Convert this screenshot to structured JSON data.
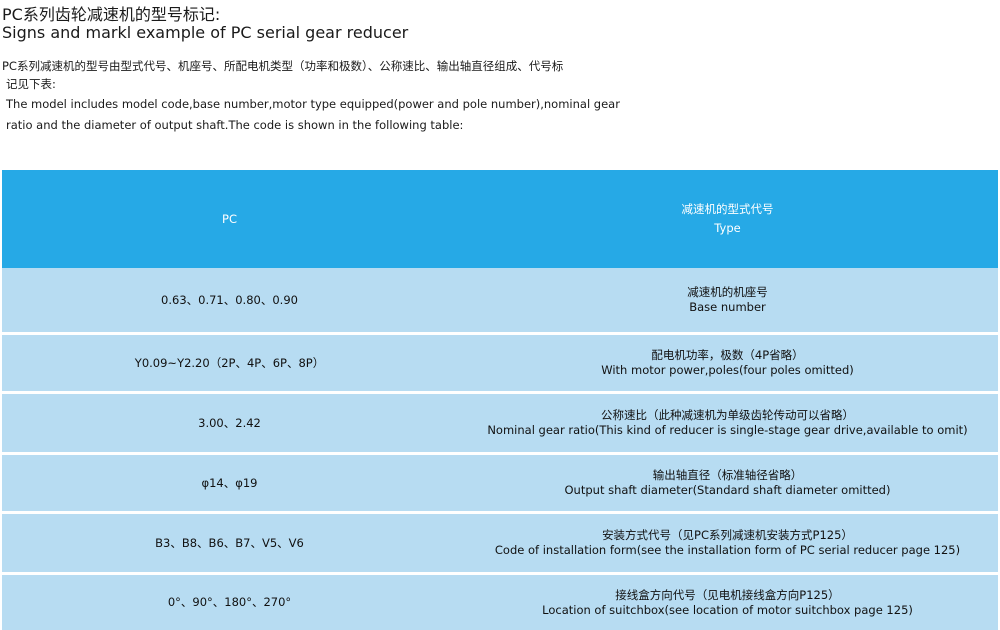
{
  "heading": {
    "title_cn": "PC系列齿轮减速机的型号标记:",
    "title_en": "Signs and markl example of PC serial gear reducer"
  },
  "intro": {
    "line1": "PC系列减速机的型号由型式代号、机座号、所配电机类型（功率和极数）、公称速比、输出轴直径组成、代号标",
    "line2": "记见下表:",
    "line3": "The model includes model code,base number,motor type equipped(power and pole number),nominal gear",
    "line4": "ratio and the diameter of output shaft.The code is shown in the following table:"
  },
  "table": {
    "header": {
      "left": "PC",
      "right_cn": "减速机的型式代号",
      "right_en": "Type"
    },
    "rows": [
      {
        "left": "0.63、0.71、0.80、0.90",
        "right_cn": "减速机的机座号",
        "right_en": "Base number"
      },
      {
        "left": "Y0.09~Y2.20（2P、4P、6P、8P）",
        "right_cn": "配电机功率，极数（4P省略）",
        "right_en": "With motor power,poles(four poles omitted)"
      },
      {
        "left": "3.00、2.42",
        "right_cn": "公称速比（此种减速机为单级齿轮传动可以省略）",
        "right_en": "Nominal gear ratio(This kind of reducer is single-stage gear drive,available to omit)"
      },
      {
        "left": "φ14、φ19",
        "right_cn": "输出轴直径（标准轴径省略）",
        "right_en": "Output shaft diameter(Standard shaft diameter omitted)"
      },
      {
        "left": "B3、B8、B6、B7、V5、V6",
        "right_cn": "安装方式代号（见PC系列减速机安装方式P125）",
        "right_en": "Code of installation form(see the installation form of PC serial reducer page 125)"
      },
      {
        "left": "0°、90°、180°、270°",
        "right_cn": "接线盒方向代号（见电机接线盒方向P125）",
        "right_en": "Location of suitchbox(see location of motor suitchbox page 125)"
      }
    ]
  },
  "colors": {
    "header_bg": "#26a9e6",
    "row_bg": "#b7dcf2",
    "header_text": "#ffffff"
  }
}
